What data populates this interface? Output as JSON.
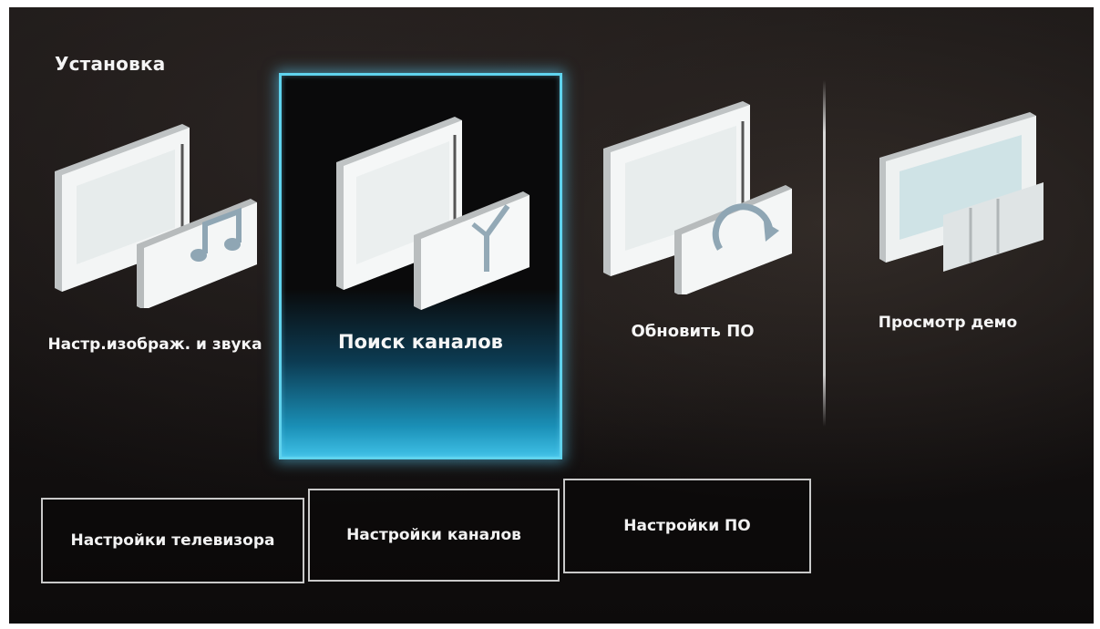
{
  "header": {
    "title": "Установка"
  },
  "tiles": [
    {
      "label": "Настр.изображ. и звука",
      "icon": "picture-sound-icon",
      "selected": false
    },
    {
      "label": "Поиск каналов",
      "icon": "antenna-icon",
      "selected": true
    },
    {
      "label": "Обновить ПО",
      "icon": "update-icon",
      "selected": false
    },
    {
      "label": "Просмотр демо",
      "icon": "demo-icon",
      "selected": false
    }
  ],
  "buttons": [
    {
      "label": "Настройки телевизора"
    },
    {
      "label": "Настройки каналов"
    },
    {
      "label": "Настройки ПО"
    }
  ],
  "colors": {
    "highlight": "#5fd3ee",
    "background": "#161313",
    "text": "#f6f6f6"
  }
}
